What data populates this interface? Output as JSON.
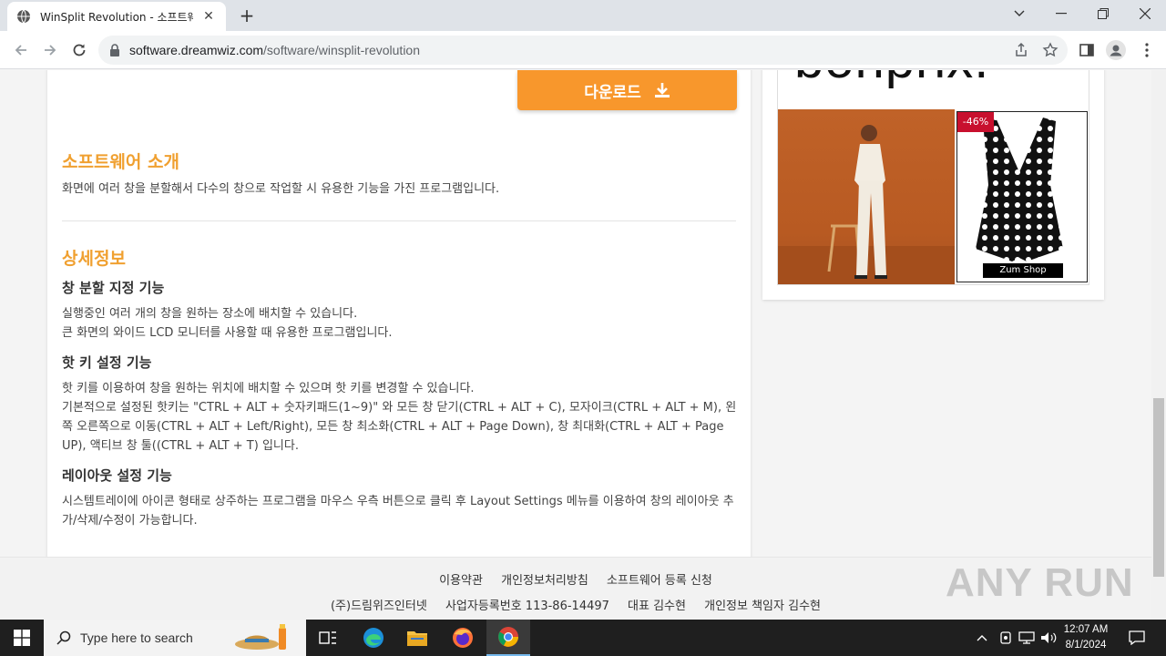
{
  "browser": {
    "tab_title": "WinSplit Revolution - 소프트웨어",
    "url_host": "software.dreamwiz.com",
    "url_path": "/software/winsplit-revolution"
  },
  "page": {
    "download_label": "다운로드",
    "intro": {
      "title": "소프트웨어 소개",
      "text": "화면에 여러 창을 분할해서 다수의 창으로 작업할 시 유용한 기능을 가진 프로그램입니다."
    },
    "details": {
      "title": "상세정보",
      "features": [
        {
          "title": "창 분할 지정 기능",
          "lines": [
            "실행중인 여러 개의 창을 원하는 장소에 배치할 수 있습니다.",
            "큰 화면의 와이드 LCD 모니터를 사용할 때 유용한 프로그램입니다."
          ]
        },
        {
          "title": "핫 키 설정 기능",
          "lines": [
            "핫 키를 이용하여 창을 원하는 위치에 배치할 수 있으며 핫 키를 변경할 수 있습니다.",
            "기본적으로 설정된 핫키는 \"CTRL + ALT + 숫자키패드(1~9)\" 와 모든 창 닫기(CTRL + ALT + C), 모자이크(CTRL + ALT + M), 왼쪽 오른쪽으로 이동(CTRL + ALT + Left/Right), 모든 창 최소화(CTRL + ALT + Page Down), 창 최대화(CTRL + ALT + Page UP), 액티브 창 툴((CTRL + ALT + T) 입니다."
          ]
        },
        {
          "title": "레이아웃 설정 기능",
          "lines": [
            "시스템트레이에 아이콘 형태로 상주하는 프로그램을 마우스 우측 버튼으로 클릭 후 Layout Settings 메뉴를 이용하여 창의 레이아웃 추가/삭제/수정이 가능합니다."
          ]
        }
      ]
    }
  },
  "ad": {
    "logo": "bonprix.",
    "badge": "-46%",
    "shop_label": "Zum Shop"
  },
  "footer": {
    "links": [
      "이용약관",
      "개인정보처리방침",
      "소프트웨어 등록 신청"
    ],
    "info": [
      "(주)드림위즈인터넷",
      "사업자등록번호 113-86-14497",
      "대표 김수현",
      "개인정보 책임자 김수현"
    ]
  },
  "watermark": "ANY RUN",
  "taskbar": {
    "search_placeholder": "Type here to search",
    "time": "12:07 AM",
    "date": "8/1/2024"
  },
  "icons": [
    "globe-icon",
    "close-icon",
    "plus-icon",
    "chevron-down-icon",
    "minimize-icon",
    "maximize-icon",
    "back-icon",
    "forward-icon",
    "reload-icon",
    "lock-icon",
    "share-icon",
    "star-icon",
    "sidebar-icon",
    "profile-icon",
    "more-icon",
    "download-icon",
    "windows-icon",
    "search-icon",
    "task-view-icon",
    "edge-icon",
    "file-explorer-icon",
    "firefox-icon",
    "chrome-icon",
    "notification-icon"
  ]
}
